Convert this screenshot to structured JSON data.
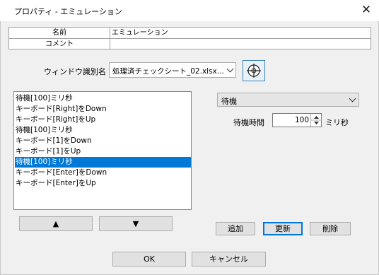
{
  "window": {
    "title": "プロパティ - エミュレーション",
    "close_label": "✕"
  },
  "properties": {
    "rows": [
      {
        "key": "名前",
        "value": "エミュレーション"
      },
      {
        "key": "コメント",
        "value": ""
      }
    ]
  },
  "window_id": {
    "label": "ウィンドウ識別名",
    "selected": "処理済チェックシート_02.xlsx...",
    "target_icon": "crosshair-target-icon"
  },
  "action_list": {
    "items": [
      "待機[100]ミリ秒",
      "キーボード[Right]をDown",
      "キーボード[Right]をUp",
      "待機[100]ミリ秒",
      "キーボード[1]をDown",
      "キーボード[1]をUp",
      "待機[100]ミリ秒",
      "キーボード[Enter]をDown",
      "キーボード[Enter]をUp"
    ],
    "selected_index": 6
  },
  "move_buttons": {
    "up_label": "▲",
    "down_label": "▼"
  },
  "action_type": {
    "selected": "待機"
  },
  "wait": {
    "label": "待機時間",
    "value": "100",
    "unit": "ミリ秒"
  },
  "edit_buttons": {
    "add": "追加",
    "update": "更新",
    "delete": "削除"
  },
  "dialog_buttons": {
    "ok": "OK",
    "cancel": "キャンセル"
  },
  "colors": {
    "selection": "#0078d7",
    "focus_border": "#0078d7"
  }
}
